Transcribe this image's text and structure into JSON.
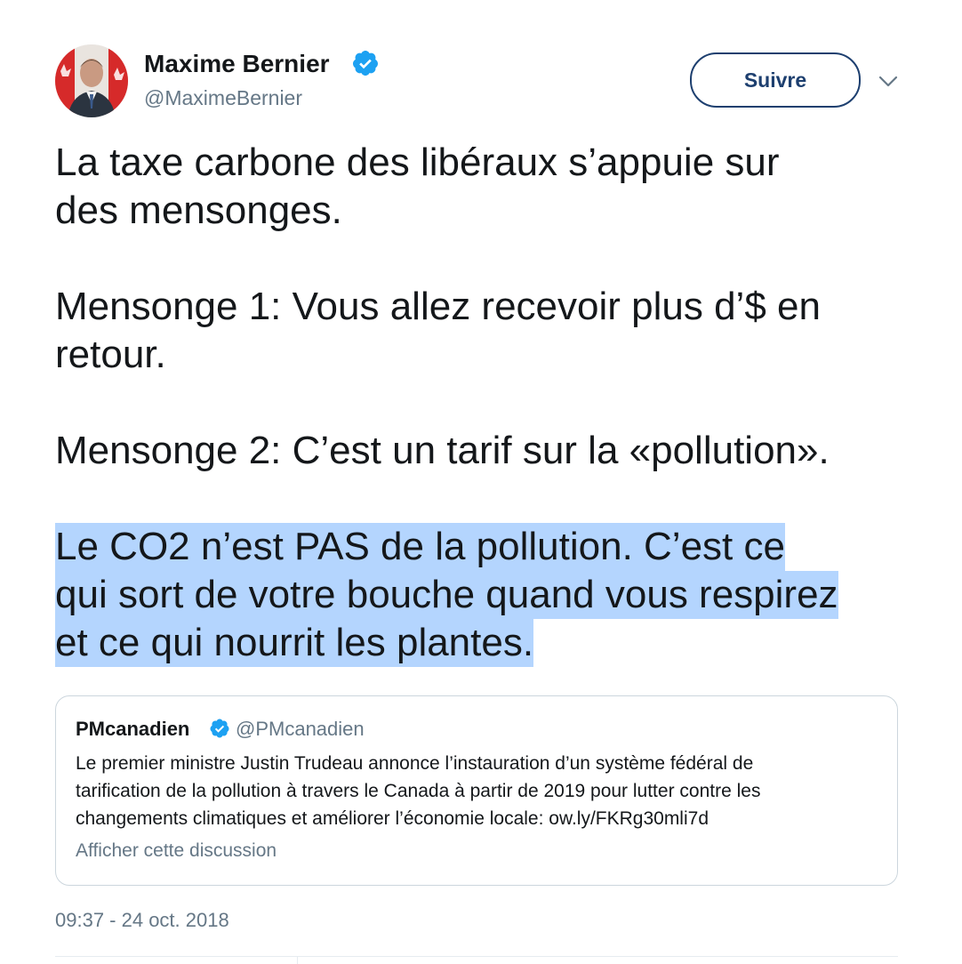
{
  "author": {
    "name": "Maxime Bernier",
    "handle": "@MaximeBernier",
    "verified": true
  },
  "follow_button": {
    "label": "Suivre"
  },
  "menu": {
    "icon": "chevron-down-icon"
  },
  "tweet": {
    "paragraphs": [
      [
        "La taxe carbone des libéraux s’appuie sur",
        "des mensonges."
      ],
      [
        "Mensonge 1: Vous allez recevoir plus d’$ en",
        "retour."
      ],
      [
        "Mensonge 2: C’est un tarif sur la «pollution»."
      ],
      [
        "Le CO2 n’est PAS de la pollution. C’est ce",
        "qui sort de votre bouche quand vous respirez",
        "et ce qui nourrit les plantes."
      ]
    ],
    "highlight_color": "#b4d5fe"
  },
  "quoted_tweet": {
    "name": "PMcanadien",
    "handle": "@PMcanadien",
    "verified": true,
    "text_lines": [
      "Le premier ministre Justin Trudeau annonce l’instauration d’un système fédéral de",
      "tarification de la pollution à travers le Canada à partir de 2019 pour lutter contre les",
      "changements climatiques et améliorer l’économie locale: ow.ly/FKRg30mli7d"
    ],
    "show_thread_label": "Afficher cette discussion"
  },
  "timestamp": "09:37 - 24 oct. 2018",
  "colors": {
    "verified_blue": "#1da1f2",
    "follow_border": "#1d3f6f",
    "secondary_text": "#657786"
  }
}
